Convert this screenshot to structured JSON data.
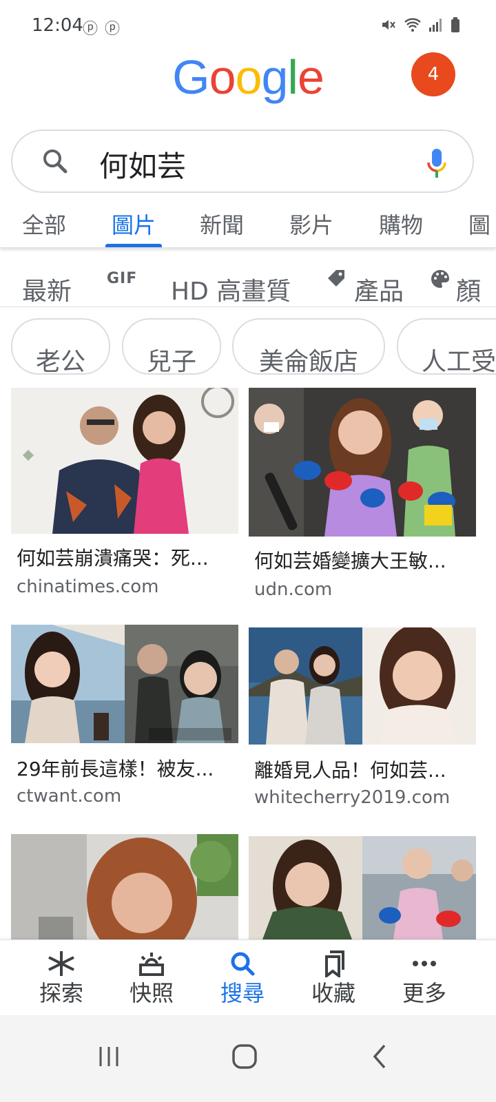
{
  "status": {
    "time": "12:04",
    "left_icons": [
      "ⓟ",
      "ⓟ"
    ],
    "right_icons": [
      "mute-icon",
      "wifi-icon",
      "signal-icon",
      "battery-icon"
    ]
  },
  "header": {
    "logo_letters": [
      "G",
      "o",
      "o",
      "g",
      "l",
      "e"
    ],
    "logo_colors": [
      "#4285F4",
      "#EA4335",
      "#FBBC05",
      "#4285F4",
      "#34A853",
      "#EA4335"
    ],
    "avatar_count": "4"
  },
  "search": {
    "query": "何如芸"
  },
  "tabs": [
    {
      "label": "全部"
    },
    {
      "label": "圖片",
      "active": true
    },
    {
      "label": "新聞"
    },
    {
      "label": "影片"
    },
    {
      "label": "購物"
    },
    {
      "label": "圖"
    }
  ],
  "filters": {
    "newest": "最新",
    "gif": "GIF",
    "hd": "HD 高畫質",
    "products": "產品",
    "color": "顏"
  },
  "chips": [
    "老公",
    "兒子",
    "美侖飯店",
    "人工受"
  ],
  "results": [
    {
      "title": "何如芸崩潰痛哭：死...",
      "source": "chinatimes.com"
    },
    {
      "title": "何如芸婚變擴大王敏...",
      "source": "udn.com"
    },
    {
      "title": "29年前長這樣！被友...",
      "source": "ctwant.com"
    },
    {
      "title": "離婚見人品！何如芸...",
      "source": "whitecherry2019.com"
    }
  ],
  "bottom_nav": [
    {
      "label": "探索",
      "icon": "asterisk-icon"
    },
    {
      "label": "快照",
      "icon": "snapshot-icon"
    },
    {
      "label": "搜尋",
      "icon": "search-icon",
      "active": true
    },
    {
      "label": "收藏",
      "icon": "collections-icon"
    },
    {
      "label": "更多",
      "icon": "more-icon"
    }
  ],
  "colors": {
    "accent": "#1a73e8",
    "avatar": "#e8491d"
  }
}
